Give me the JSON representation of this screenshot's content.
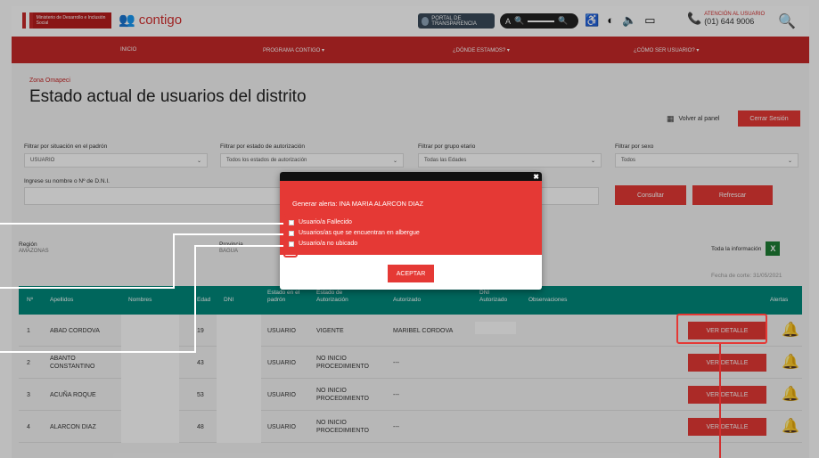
{
  "header": {
    "gov_logo_text": "Ministerio de Desarrollo e Inclusión Social",
    "brand": "contigo",
    "portal_label": "PORTAL DE TRANSPARENCIA",
    "zoom_label": "A",
    "help_title": "ATENCIÓN AL USUARIO",
    "help_phone": "(01) 644 9006"
  },
  "nav": [
    "INICIO",
    "PROGRAMA CONTIGO ▾",
    "¿DÓNDE ESTAMOS? ▾",
    "¿CÓMO SER USUARIO? ▾"
  ],
  "page": {
    "breadcrumb": "Zona Omapeci",
    "title": "Estado actual de usuarios del distrito",
    "volver": "Volver al panel",
    "cerrar": "Cerrar Sesión"
  },
  "filters": {
    "situacion_label": "Filtrar por situación en el padrón",
    "situacion_value": "USUARIO",
    "autorizacion_label": "Filtrar por estado de autorización",
    "autorizacion_value": "Todos los estados de autorización",
    "grupo_label": "Filtrar por grupo etario",
    "grupo_value": "Todas las Edades",
    "sexo_label": "Filtrar por sexo",
    "sexo_value": "Todos",
    "nombre_label": "Ingrese su nombre o Nº de D.N.I.",
    "consultar": "Consultar",
    "refrescar": "Refrescar"
  },
  "location": {
    "region_label": "Región",
    "region_value": "AMAZONAS",
    "provincia_label": "Provincia",
    "provincia_value": "BAGUA",
    "toda_info": "Toda la información",
    "fecha_corte": "Fecha de corte: 31/05/2021"
  },
  "table": {
    "headers": [
      "Nº",
      "Apellidos",
      "Nombres",
      "Edad",
      "DNI",
      "Estado en el padrón",
      "Estado de Autorización",
      "Autorizado",
      "DNI Autorizado",
      "Observaciones",
      "Alertas"
    ],
    "rows": [
      {
        "n": "1",
        "apellidos": "ABAD CORDOVA",
        "edad": "19",
        "padron": "USUARIO",
        "autorizacion": "VIGENTE",
        "autorizado": "MARIBEL CORDOVA",
        "accion": "VER DETALLE"
      },
      {
        "n": "2",
        "apellidos": "ABANTO CONSTANTINO",
        "edad": "43",
        "padron": "USUARIO",
        "autorizacion": "NO INICIO PROCEDIMIENTO",
        "autorizado": "---",
        "accion": "VER DETALLE"
      },
      {
        "n": "3",
        "apellidos": "ACUÑA ROQUE",
        "edad": "53",
        "padron": "USUARIO",
        "autorizacion": "NO INICIO PROCEDIMIENTO",
        "autorizado": "---",
        "accion": "VER DETALLE"
      },
      {
        "n": "4",
        "apellidos": "ALARCON DIAZ",
        "edad": "48",
        "padron": "USUARIO",
        "autorizacion": "NO INICIO PROCEDIMIENTO",
        "autorizado": "---",
        "accion": "VER DETALLE"
      }
    ]
  },
  "modal": {
    "title": "Generar alerta: INA MARIA ALARCON DIAZ",
    "options": [
      "Usuario/a Fallecido",
      "Usuarios/as que se encuentran en albergue",
      "Usuario/a no ubicado"
    ],
    "accept": "ACEPTAR"
  },
  "colors": {
    "accent": "#c62828",
    "teal": "#00897b"
  }
}
